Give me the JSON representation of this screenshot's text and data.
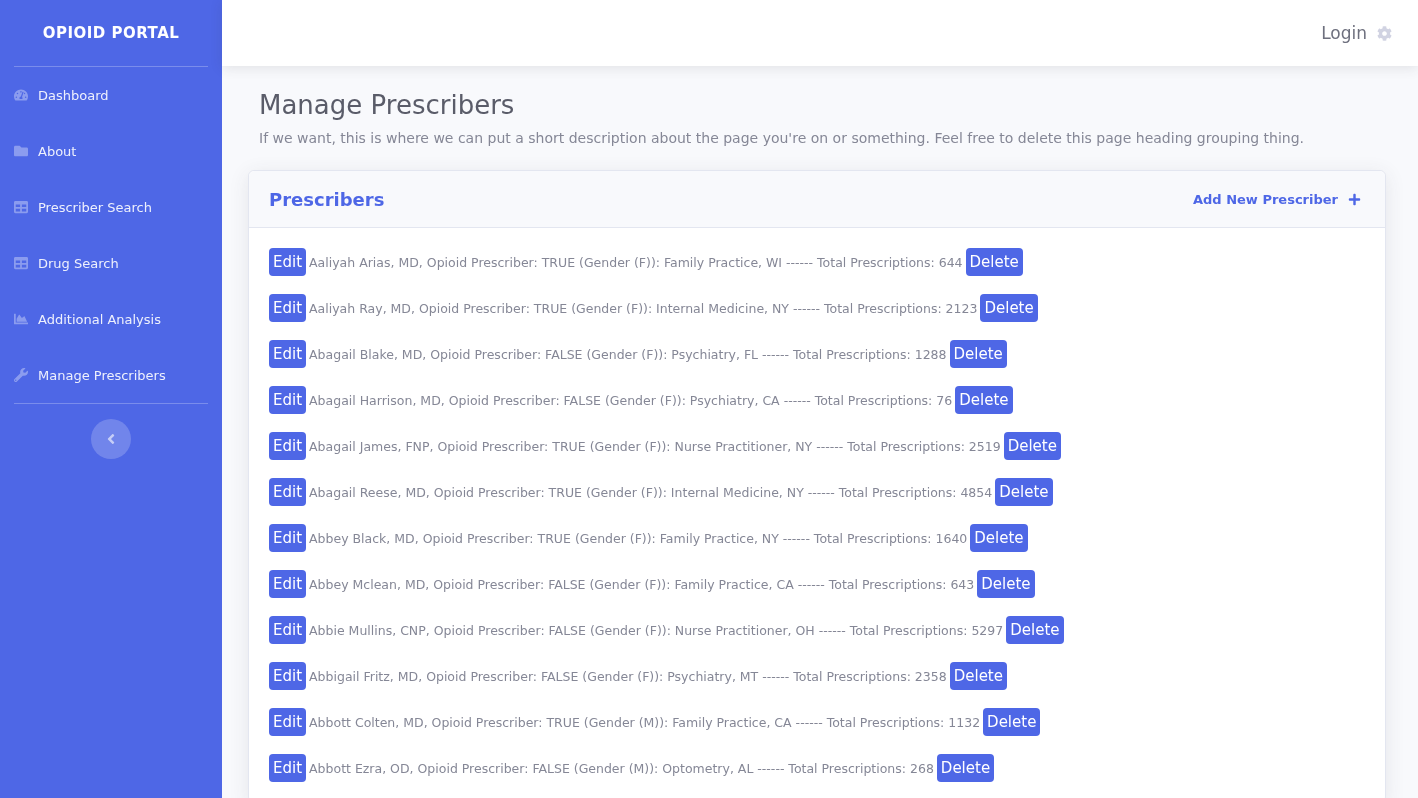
{
  "sidebar": {
    "brand": "OPIOID PORTAL",
    "items": [
      {
        "label": "Dashboard"
      },
      {
        "label": "About"
      },
      {
        "label": "Prescriber Search"
      },
      {
        "label": "Drug Search"
      },
      {
        "label": "Additional Analysis"
      },
      {
        "label": "Manage Prescribers"
      }
    ]
  },
  "topbar": {
    "login": "Login"
  },
  "page": {
    "title": "Manage Prescribers",
    "description": "If we want, this is where we can put a short description about the page you're on or something. Feel free to delete this page heading grouping thing."
  },
  "card": {
    "title": "Prescribers",
    "add_link": "Add New Prescriber",
    "rows": [
      {
        "edit": "Edit",
        "text": "Aaliyah Arias, MD, Opioid Prescriber: TRUE (Gender (F)): Family Practice, WI ------ Total Prescriptions: 644",
        "delete": "Delete"
      },
      {
        "edit": "Edit",
        "text": "Aaliyah Ray, MD, Opioid Prescriber: TRUE (Gender (F)): Internal Medicine, NY ------ Total Prescriptions: 2123",
        "delete": "Delete"
      },
      {
        "edit": "Edit",
        "text": "Abagail Blake, MD, Opioid Prescriber: FALSE (Gender (F)): Psychiatry, FL ------ Total Prescriptions: 1288",
        "delete": "Delete"
      },
      {
        "edit": "Edit",
        "text": "Abagail Harrison, MD, Opioid Prescriber: FALSE (Gender (F)): Psychiatry, CA ------ Total Prescriptions: 76",
        "delete": "Delete"
      },
      {
        "edit": "Edit",
        "text": "Abagail James, FNP, Opioid Prescriber: TRUE (Gender (F)): Nurse Practitioner, NY ------ Total Prescriptions: 2519",
        "delete": "Delete"
      },
      {
        "edit": "Edit",
        "text": "Abagail Reese, MD, Opioid Prescriber: TRUE (Gender (F)): Internal Medicine, NY ------ Total Prescriptions: 4854",
        "delete": "Delete"
      },
      {
        "edit": "Edit",
        "text": "Abbey Black, MD, Opioid Prescriber: TRUE (Gender (F)): Family Practice, NY ------ Total Prescriptions: 1640",
        "delete": "Delete"
      },
      {
        "edit": "Edit",
        "text": "Abbey Mclean, MD, Opioid Prescriber: FALSE (Gender (F)): Family Practice, CA ------ Total Prescriptions: 643",
        "delete": "Delete"
      },
      {
        "edit": "Edit",
        "text": "Abbie Mullins, CNP, Opioid Prescriber: FALSE (Gender (F)): Nurse Practitioner, OH ------ Total Prescriptions: 5297",
        "delete": "Delete"
      },
      {
        "edit": "Edit",
        "text": "Abbigail Fritz, MD, Opioid Prescriber: FALSE (Gender (F)): Psychiatry, MT ------ Total Prescriptions: 2358",
        "delete": "Delete"
      },
      {
        "edit": "Edit",
        "text": "Abbott Colten, MD, Opioid Prescriber: TRUE (Gender (M)): Family Practice, CA ------ Total Prescriptions: 1132",
        "delete": "Delete"
      },
      {
        "edit": "Edit",
        "text": "Abbott Ezra, OD, Opioid Prescriber: FALSE (Gender (M)): Optometry, AL ------ Total Prescriptions: 268",
        "delete": "Delete"
      }
    ]
  }
}
